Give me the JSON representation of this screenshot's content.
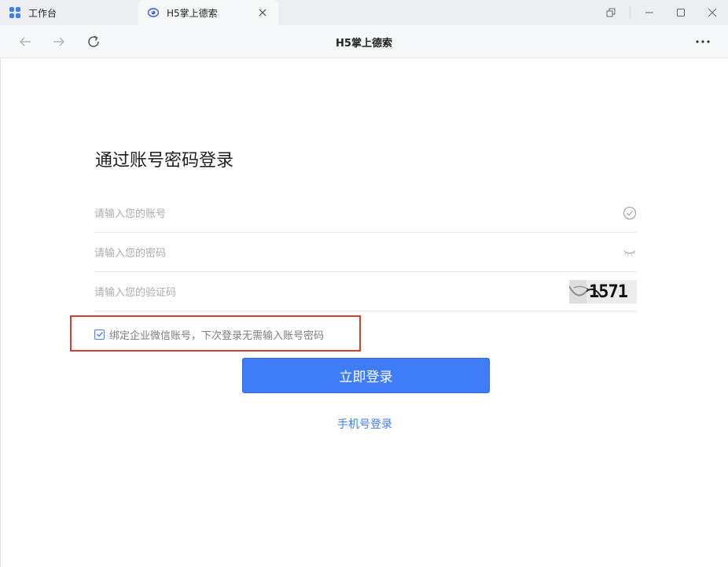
{
  "tabs": [
    {
      "label": "工作台",
      "active": false,
      "icon": "grid-apps-icon"
    },
    {
      "label": "H5掌上德索",
      "active": true,
      "icon": "eye-logo-icon"
    }
  ],
  "window_controls": [
    "restore-icon",
    "minimize-icon",
    "maximize-icon",
    "close-icon"
  ],
  "nav": {
    "title": "H5掌上德索"
  },
  "login": {
    "title": "通过账号密码登录",
    "account_placeholder": "请输入您的账号",
    "password_placeholder": "请输入您的密码",
    "captcha_placeholder": "请输入您的验证码",
    "captcha_text": "1571",
    "bind_label": "绑定企业微信账号，下次登录无需输入账号密码",
    "bind_checked": true,
    "submit_label": "立即登录",
    "phone_login_label": "手机号登录"
  },
  "colors": {
    "accent": "#3f7cf7",
    "highlight_box": "#e03a2f"
  }
}
